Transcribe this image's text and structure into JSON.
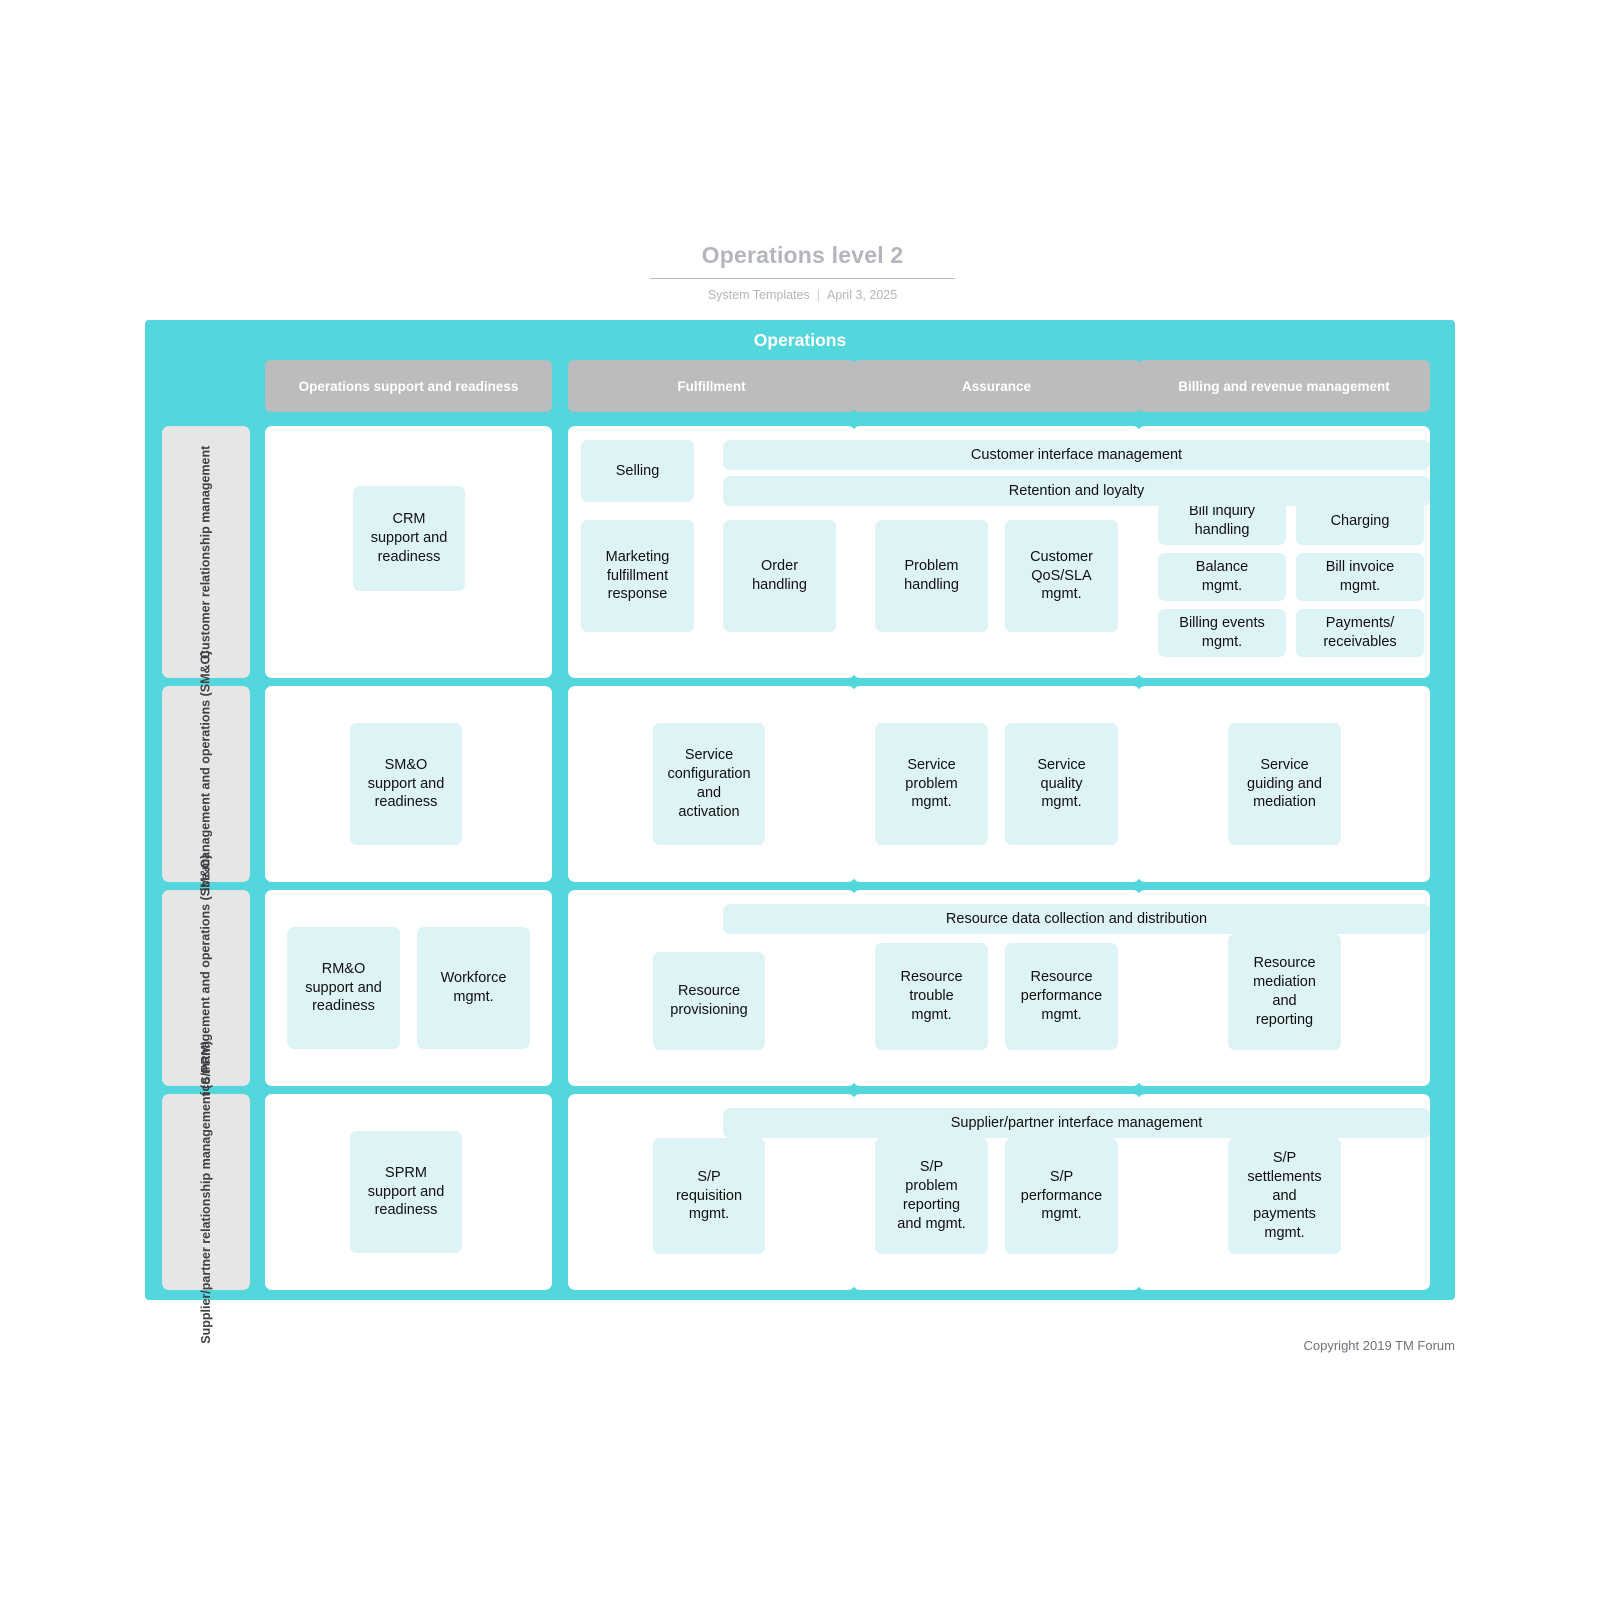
{
  "header": {
    "title": "Operations level 2",
    "subtitle_left": "System Templates",
    "subtitle_divider": "|",
    "subtitle_right": "April 3, 2025"
  },
  "frame": {
    "title": "Operations"
  },
  "colors": {
    "frame_teal": "#53d6dc",
    "column_header_gray": "#bbbcbe",
    "row_label_gray": "#e6e6e6",
    "box_light_blue": "#ddf3f5",
    "title_gray": "#b4b6bd"
  },
  "columns": [
    {
      "label": "Operations support and readiness"
    },
    {
      "label": "Fulfillment"
    },
    {
      "label": "Assurance"
    },
    {
      "label": "Billing and revenue management"
    }
  ],
  "rows": [
    {
      "label": "Customer relationship management"
    },
    {
      "label": "Service management and operations (SM&O)"
    },
    {
      "label": "Service management and operations (SM&O)"
    },
    {
      "label": "Supplier/partner relationship management (S/PRM)"
    }
  ],
  "bands": {
    "customer_interface_management": "Customer interface management",
    "retention_and_loyalty": "Retention and loyalty",
    "resource_data_collection": "Resource data collection and distribution",
    "supplier_partner_interface": "Supplier/partner interface management"
  },
  "boxes": {
    "crm_support": "CRM\nsupport and\nreadiness",
    "selling": "Selling",
    "marketing_fulfillment": "Marketing\nfulfillment\nresponse",
    "order_handling": "Order\nhandling",
    "problem_handling": "Problem\nhandling",
    "customer_qos_sla": "Customer\nQoS/SLA\nmgmt.",
    "bill_inquiry_handling": "Bill inquiry\nhandling",
    "charging": "Charging",
    "balance_mgmt": "Balance\nmgmt.",
    "bill_invoice_mgmt": "Bill invoice\nmgmt.",
    "billing_events_mgmt": "Billing events\nmgmt.",
    "payments_receivables": "Payments/\nreceivables",
    "smo_support": "SM&O\nsupport and\nreadiness",
    "service_config_activation": "Service\nconfiguration\nand\nactivation",
    "service_problem_mgmt": "Service\nproblem\nmgmt.",
    "service_quality_mgmt": "Service\nquality\nmgmt.",
    "service_guiding_mediation": "Service\nguiding and\nmediation",
    "rmo_support": "RM&O\nsupport and\nreadiness",
    "workforce_mgmt": "Workforce\nmgmt.",
    "resource_provisioning": "Resource\nprovisioning",
    "resource_trouble_mgmt": "Resource\ntrouble\nmgmt.",
    "resource_performance_mgmt": "Resource\nperformance\nmgmt.",
    "resource_mediation_reporting": "Resource\nmediation\nand\nreporting",
    "sprm_support": "SPRM\nsupport and\nreadiness",
    "sp_requisition_mgmt": "S/P\nrequisition\nmgmt.",
    "sp_problem_reporting": "S/P\nproblem\nreporting\nand mgmt.",
    "sp_performance_mgmt": "S/P\nperformance\nmgmt.",
    "sp_settlements_payments": "S/P\nsettlements\nand\npayments\nmgmt."
  },
  "footer": {
    "copyright": "Copyright 2019 TM Forum"
  }
}
